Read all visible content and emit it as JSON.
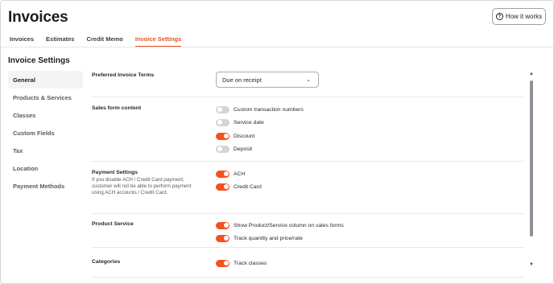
{
  "page": {
    "title": "Invoices"
  },
  "header": {
    "how_it_works_label": "How it works",
    "how_icon": "question-circle-icon",
    "how_icon_glyph": "?"
  },
  "tabs": [
    {
      "label": "Invoices",
      "active": false
    },
    {
      "label": "Estimates",
      "active": false
    },
    {
      "label": "Credit Memo",
      "active": false
    },
    {
      "label": "Invoice Settings",
      "active": true
    }
  ],
  "settings": {
    "title": "Invoice Settings"
  },
  "sidebar": {
    "items": [
      {
        "label": "General",
        "active": true
      },
      {
        "label": "Products & Services",
        "active": false
      },
      {
        "label": "Classes",
        "active": false
      },
      {
        "label": "Custom Fields",
        "active": false
      },
      {
        "label": "Tax",
        "active": false
      },
      {
        "label": "Location",
        "active": false
      },
      {
        "label": "Payment Methods",
        "active": false
      }
    ]
  },
  "content": {
    "preferred_terms": {
      "label": "Preferred Invoice Terms",
      "value": "Due on receipt",
      "chevron_icon": "chevron-down-icon",
      "chevron_glyph": "⌄"
    },
    "sales_form": {
      "label": "Sales form content",
      "options": [
        {
          "label": "Custom transaction numbers",
          "on": false
        },
        {
          "label": "Service date",
          "on": false
        },
        {
          "label": "Discount",
          "on": true
        },
        {
          "label": "Deposit",
          "on": false
        }
      ]
    },
    "payment": {
      "label": "Payment Settings",
      "description": "If you disable ACH / Credit Card payment, customer will not be able to perform payment using ACH accounts / Credit Card.",
      "options": [
        {
          "label": "ACH",
          "on": true
        },
        {
          "label": "Credit Card",
          "on": true
        }
      ]
    },
    "product_service": {
      "label": "Product Service",
      "options": [
        {
          "label": "Show Product/Service column on sales forms",
          "on": true
        },
        {
          "label": "Track quantity and price/rate",
          "on": true
        }
      ]
    },
    "categories": {
      "label": "Categories",
      "options": [
        {
          "label": "Track classes",
          "on": true
        }
      ]
    }
  },
  "scrollbar": {
    "up_glyph": "▲",
    "down_glyph": "▼"
  },
  "colors": {
    "accent": "#f4511e",
    "toggle_off": "#d1d4d8",
    "text": "#1f2329",
    "muted": "#555b63"
  }
}
